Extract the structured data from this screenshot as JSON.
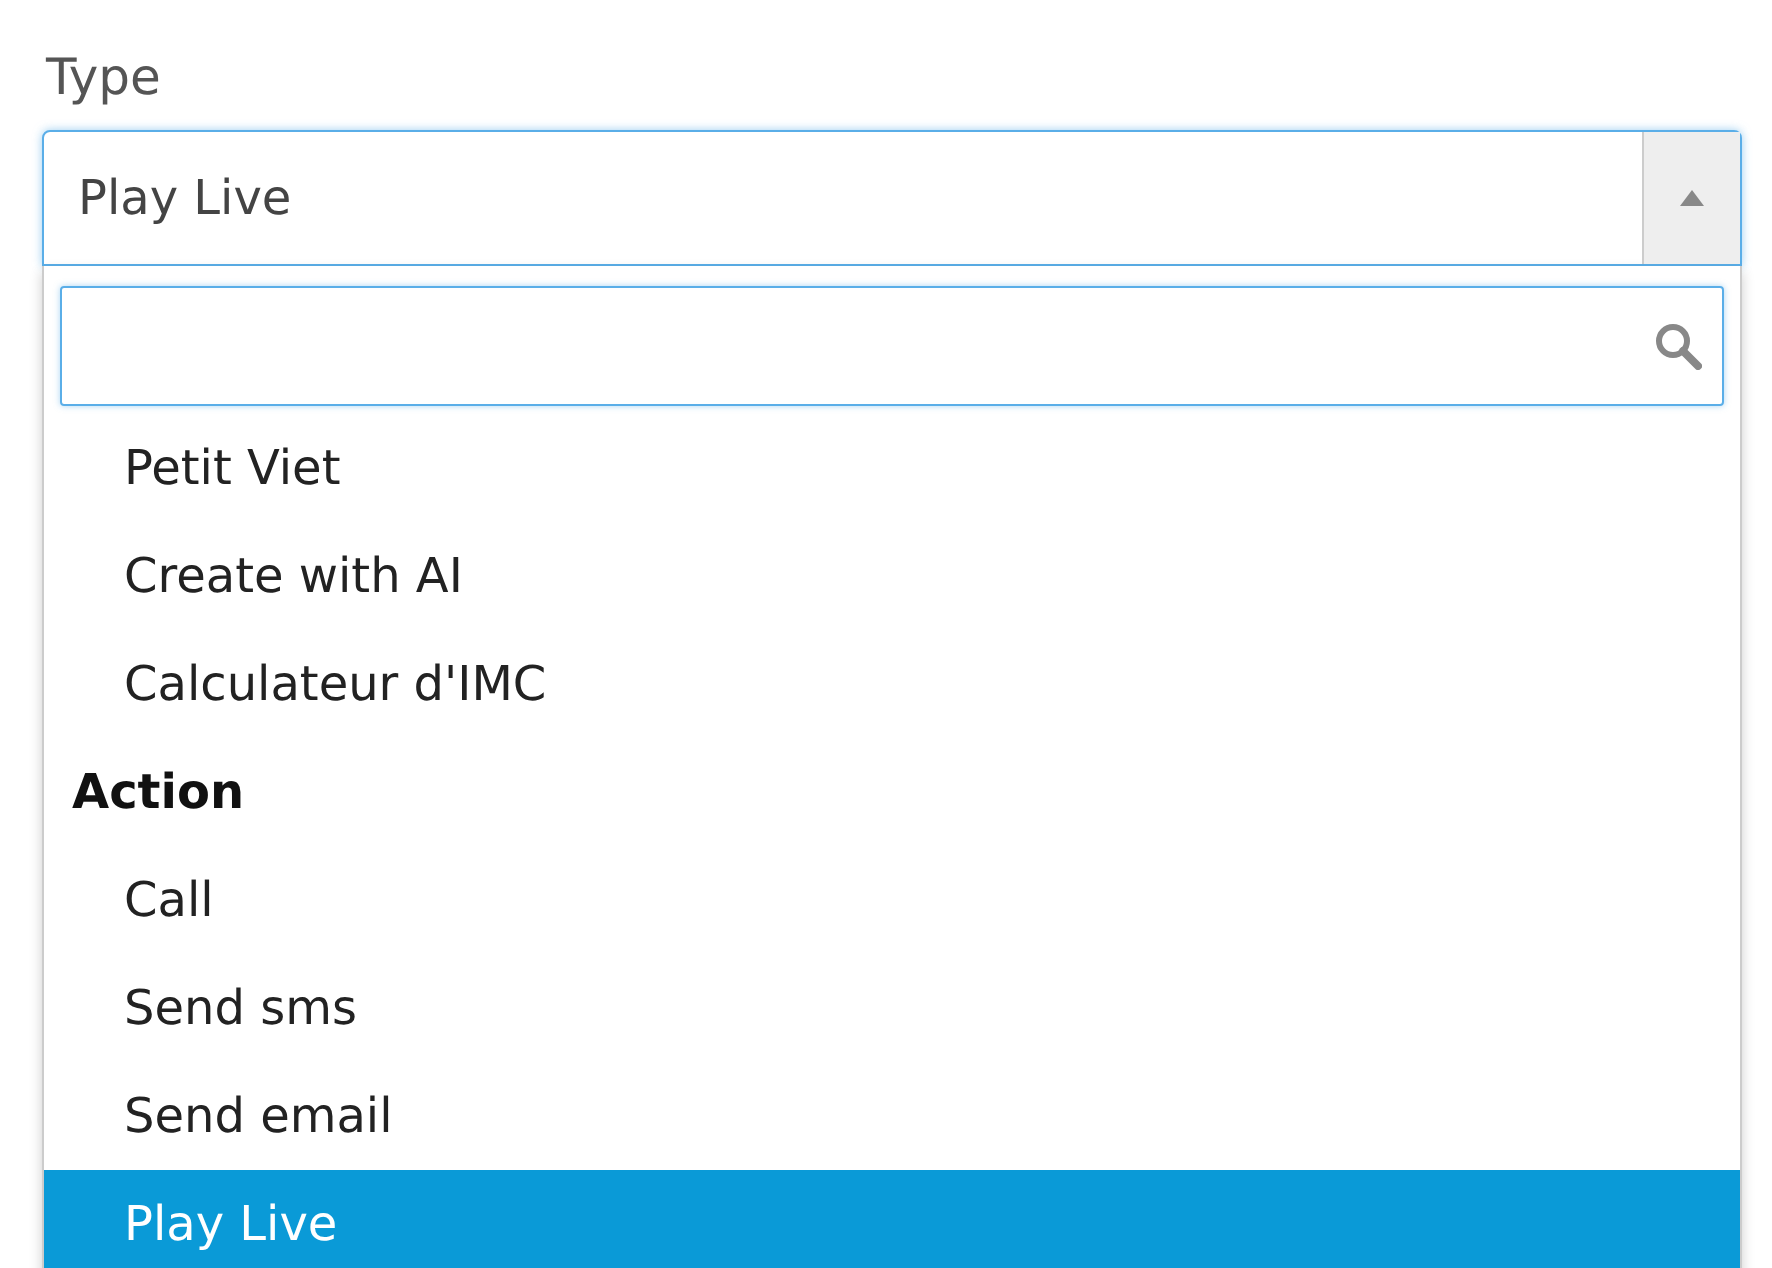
{
  "field": {
    "label": "Type",
    "value": "Play Live",
    "expanded": true
  },
  "dropdown": {
    "entries": [
      {
        "kind": "option",
        "text": "Petit Viet",
        "selected": false
      },
      {
        "kind": "option",
        "text": "Create with AI",
        "selected": false
      },
      {
        "kind": "option",
        "text": "Calculateur d'IMC",
        "selected": false
      },
      {
        "kind": "group",
        "text": "Action"
      },
      {
        "kind": "option",
        "text": "Call",
        "selected": false
      },
      {
        "kind": "option",
        "text": "Send sms",
        "selected": false
      },
      {
        "kind": "option",
        "text": "Send email",
        "selected": false
      },
      {
        "kind": "option",
        "text": "Play Live",
        "selected": true
      }
    ]
  }
}
